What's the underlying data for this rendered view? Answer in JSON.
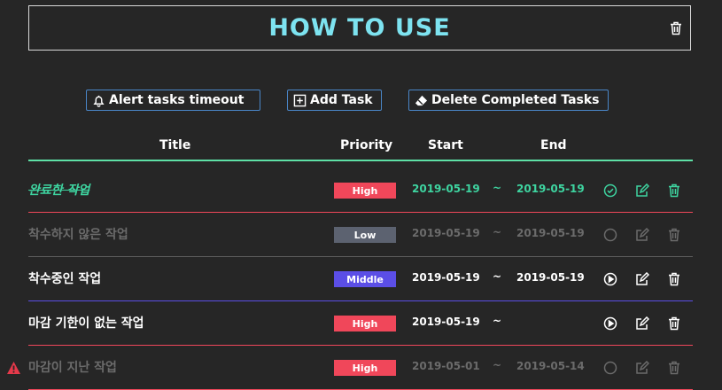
{
  "header": {
    "title": "HOW TO USE"
  },
  "toolbar": {
    "alert_label": "Alert tasks timeout",
    "add_label": "Add Task",
    "delete_label": "Delete Completed Tasks"
  },
  "columns": {
    "title": "Title",
    "priority": "Priority",
    "start": "Start",
    "end": "End"
  },
  "colors": {
    "accent": "#7de3f0",
    "high": "#f0475a",
    "low": "#5c6270",
    "middle": "#5b4ee6",
    "done": "#3ed4a0",
    "muted": "#6b6b6b"
  },
  "tasks": [
    {
      "title": "완료한 작업",
      "priority": "High",
      "start": "2019-05-19",
      "tilde": "~",
      "end": "2019-05-19",
      "status": "done"
    },
    {
      "title": "착수하지 않은 작업",
      "priority": "Low",
      "start": "2019-05-19",
      "tilde": "~",
      "end": "2019-05-19",
      "status": "not-started"
    },
    {
      "title": "착수중인 작업",
      "priority": "Middle",
      "start": "2019-05-19",
      "tilde": "~",
      "end": "2019-05-19",
      "status": "in-progress"
    },
    {
      "title": "마감 기한이 없는 작업",
      "priority": "High",
      "start": "2019-05-19",
      "tilde": "~",
      "end": "",
      "status": "in-progress"
    },
    {
      "title": "마감이 지난 작업",
      "priority": "High",
      "start": "2019-05-01",
      "tilde": "~",
      "end": "2019-05-14",
      "status": "overdue"
    }
  ]
}
